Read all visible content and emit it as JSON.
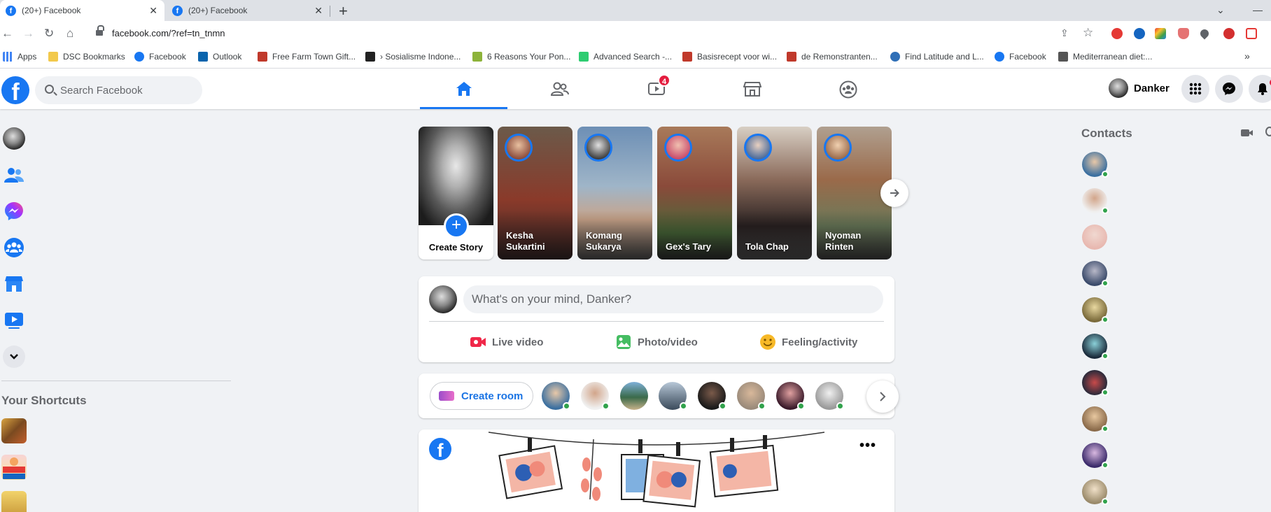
{
  "browser": {
    "tabs": [
      {
        "title": "(20+) Facebook",
        "active": true
      },
      {
        "title": "(20+) Facebook",
        "active": false
      }
    ],
    "url": "facebook.com/?ref=tn_tnmn",
    "bookmarks": [
      {
        "label": "Apps",
        "icon": "apps-grid-icon",
        "color": "#ea4335"
      },
      {
        "label": "DSC Bookmarks",
        "icon": "folder-icon",
        "color": "#f2c94c"
      },
      {
        "label": "Facebook",
        "icon": "facebook-icon",
        "color": "#1877f2"
      },
      {
        "label": "Outlook",
        "icon": "outlook-icon",
        "color": "#0a64ad"
      },
      {
        "label": "Free Farm Town Gift...",
        "icon": "farm-town-icon",
        "color": "#c0392b"
      },
      {
        "label": "› Sosialisme Indone...",
        "icon": "s-icon",
        "color": "#222222"
      },
      {
        "label": "6 Reasons Your Pon...",
        "icon": "pond-icon",
        "color": "#8db33a"
      },
      {
        "label": "Advanced Search -...",
        "icon": "search-site-icon",
        "color": "#2ecc71"
      },
      {
        "label": "Basisrecept voor wi...",
        "icon": "recipe-icon",
        "color": "#c0392b"
      },
      {
        "label": "de Remonstranten...",
        "icon": "remonstranten-icon",
        "color": "#c0392b"
      },
      {
        "label": "Find Latitude and L...",
        "icon": "globe-icon",
        "color": "#2f6fb7"
      },
      {
        "label": "Facebook",
        "icon": "facebook-icon",
        "color": "#1877f2"
      },
      {
        "label": "Mediterranean diet:...",
        "icon": "diet-icon",
        "color": "#555555"
      }
    ]
  },
  "header": {
    "search_placeholder": "Search Facebook",
    "watch_badge": "4",
    "profile_name": "Danker"
  },
  "left_sidebar": {
    "shortcuts_title": "Your Shortcuts"
  },
  "stories": {
    "create_label": "Create Story",
    "items": [
      {
        "name": "Kesha Sukartini",
        "bg": "linear-gradient(#6b5a4a,#8a3a2a 55%,#3a2a2a)"
      },
      {
        "name": "Komang Sukarya",
        "bg": "linear-gradient(#6d8fb5,#9fb5c8 45%,#c9a48a 70%,#555)"
      },
      {
        "name": "Gex's Tary",
        "bg": "linear-gradient(#a87a5a,#8a4a3a 45%,#4a6a3a 80%,#333)"
      },
      {
        "name": "Tola Chap",
        "bg": "linear-gradient(#d8cfc4,#8a6a5a 40%,#2a2222 75%,#555)"
      },
      {
        "name": "Nyoman Rinten",
        "bg": "linear-gradient(#b0a090,#9a6a4a 40%,#6a7a5a 75%,#444)"
      }
    ]
  },
  "composer": {
    "placeholder": "What's on your mind, Danker?",
    "actions": [
      {
        "label": "Live video",
        "color": "#f02849"
      },
      {
        "label": "Photo/video",
        "color": "#45bd62"
      },
      {
        "label": "Feeling/activity",
        "color": "#f7b928"
      }
    ]
  },
  "rooms": {
    "create_label": "Create room"
  },
  "contacts": {
    "title": "Contacts"
  },
  "colors": {
    "brand": "#1877f2",
    "online": "#31a24c",
    "badge": "#e41e3f"
  }
}
